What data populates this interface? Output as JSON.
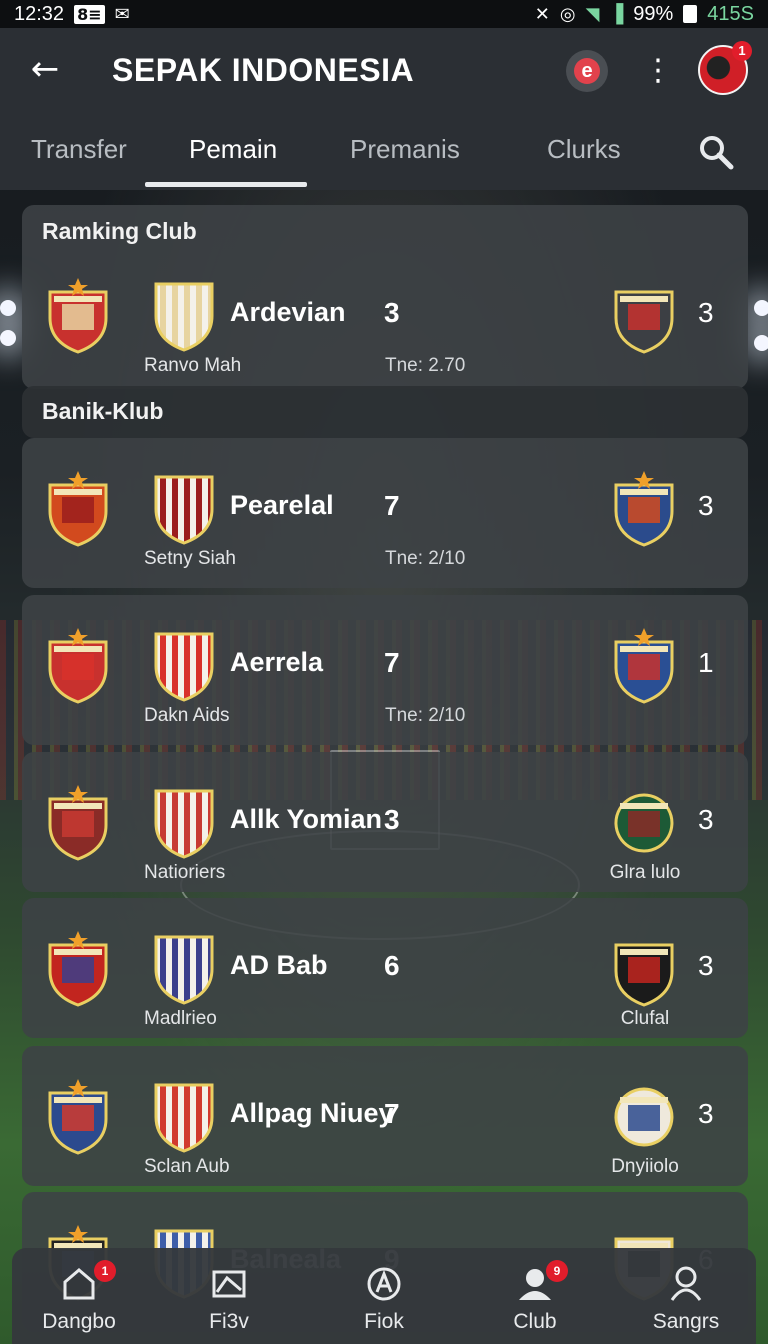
{
  "status_bar": {
    "time": "12:32",
    "left_badge": "8≡",
    "battery_percent": "99%",
    "right_text": "415S",
    "icons": [
      "notification-icon",
      "mute-icon",
      "alarm-icon",
      "wifi-icon",
      "signal-icon",
      "battery-icon"
    ]
  },
  "header": {
    "title": "SEPAK INDONESIA",
    "brand_letter": "e",
    "avatar_badge": "1"
  },
  "tabs": [
    {
      "label": "Transfer",
      "active": false
    },
    {
      "label": "Pemain",
      "active": true
    },
    {
      "label": "Premanis",
      "active": false
    },
    {
      "label": "Clurks",
      "active": false
    }
  ],
  "sections": {
    "ranking": "Ramking Club",
    "banik": "Banik-Klub"
  },
  "rows": [
    {
      "name": "Ardevian",
      "mid": "3",
      "right": "3",
      "sub": "Ranvo Mah",
      "time": "Tne: 2.70",
      "right_sub": "",
      "colors": [
        "#c8312e",
        "#e7d4a0",
        "#3c3f44"
      ]
    },
    {
      "name": "Pearelal",
      "mid": "7",
      "right": "3",
      "sub": "Setny Siah",
      "time": "Tne: 2/10",
      "right_sub": "",
      "colors": [
        "#d24a1e",
        "#9b1d1d",
        "#2b4b8c"
      ]
    },
    {
      "name": "Aerrela",
      "mid": "7",
      "right": "1",
      "sub": "Dakn Aids",
      "time": "Tne: 2/10",
      "right_sub": "",
      "colors": [
        "#c8312e",
        "#d8312a",
        "#2a4f94"
      ]
    },
    {
      "name": "Allk Yomian",
      "mid": "3",
      "right": "3",
      "sub": "Natioriers",
      "time": "",
      "right_sub": "Glra lulo",
      "colors": [
        "#8a2b27",
        "#c73a33",
        "#1d5a36"
      ]
    },
    {
      "name": "AD Bab",
      "mid": "6",
      "right": "3",
      "sub": "Madlrieo",
      "time": "",
      "right_sub": "Clufal",
      "colors": [
        "#c2251f",
        "#3b3f8c",
        "#1b1b1b"
      ]
    },
    {
      "name": "Allpag Niuey",
      "mid": "7",
      "right": "3",
      "sub": "Sclan Aub",
      "time": "",
      "right_sub": "Dnyiiolo",
      "colors": [
        "#2c4a8e",
        "#d13a2e",
        "#efe9dc"
      ]
    },
    {
      "name": "Balneala",
      "mid": "9",
      "right": "6",
      "sub": "",
      "time": "",
      "right_sub": "",
      "colors": [
        "#222222",
        "#3e5ea8",
        "#f0e8d8"
      ]
    }
  ],
  "bottom_nav": [
    {
      "label": "Dangbo",
      "icon": "home-icon",
      "badge": "1"
    },
    {
      "label": "Fi3v",
      "icon": "image-icon",
      "badge": ""
    },
    {
      "label": "Fiok",
      "icon": "compass-icon",
      "badge": ""
    },
    {
      "label": "Club",
      "icon": "profile-icon",
      "badge": "9"
    },
    {
      "label": "Sangrs",
      "icon": "user-icon",
      "badge": ""
    }
  ]
}
